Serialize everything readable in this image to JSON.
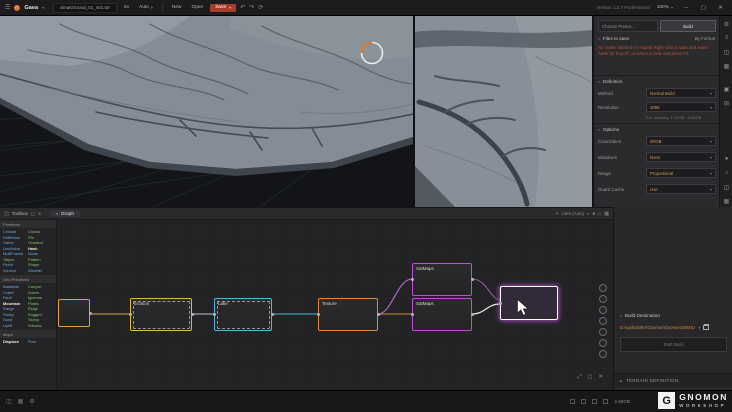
{
  "colors": {
    "accent_orange": "#cf8a3e",
    "warning_text": "#c4502e",
    "save_button": "#a93d2c",
    "node_erosion": "#e5b83c",
    "node_lake": "#49b9dd",
    "node_texture": "#e0883c",
    "node_satmaps": "#bb4fd6",
    "selection_white": "#ffffff",
    "toolbox_blue": "#6fa8dc",
    "toolbox_green": "#85c06a",
    "graph_tab_dot": "#3aa0e8",
    "gizmo_orange": "#e2762c"
  },
  "icons": {
    "menu": "☰",
    "chevron": "▾",
    "minimize": "─",
    "maximize": "▢",
    "close": "✕",
    "undo": "↶",
    "redo": "↷",
    "history": "⟳",
    "plus": "+",
    "home": "⌂",
    "grid": "▦",
    "list": "≡",
    "panel": "◫",
    "gear": "⚙",
    "dot": "●",
    "caret_up": "▲",
    "expand": "⤢",
    "frame": "◻",
    "table": "⊞",
    "square": "▣"
  },
  "titlebar": {
    "app_name": "Gaea",
    "document_tab": "SinaiGround_01_v01.tor",
    "toggle_2x": "2x",
    "auto_label": "Auto",
    "new_label": "New",
    "open_label": "Open",
    "save_label": "Save",
    "version": "Version 1.3.7 Professional",
    "zoom": "100%"
  },
  "build_panel": {
    "preset_placeholder": "Choose Preset...",
    "build_button": "Build",
    "files_to_save": "Files to save",
    "by_format": "By Format",
    "warning": "No nodes marked for export! Right-click a node and select 'Mark for Export', or select a node and press F3.",
    "definition": {
      "title": "Definition",
      "method_label": "Method",
      "method_value": "Normal Build",
      "resolution_label": "Resolution",
      "resolution_value": "4096",
      "memory_note": "Est. memory: 1.02GB - 3.48GB"
    },
    "options": {
      "title": "Options",
      "rows": [
        {
          "label": "Colorization",
          "value": "sRGB"
        },
        {
          "label": "Mutations",
          "value": "None"
        },
        {
          "label": "Range",
          "value": "Proportional"
        },
        {
          "label": "Guard Cache",
          "value": "Use"
        }
      ]
    },
    "build_destination": {
      "title": "Build Destination",
      "path": "D:\\sasha\\DEV\\Gnomon\\Gnomon3dW01r",
      "action": "Start Build"
    },
    "terrain_definition": "TERRAIN DEFINITION"
  },
  "graph": {
    "toolbox_tab": "Toolbox",
    "graph_tab": "Graph",
    "zoom_status": "Lake (Auto)",
    "toolbox": {
      "categories": [
        {
          "name": "Primitives",
          "items": [
            {
              "label": "Cellular"
            },
            {
              "label": "Cracks"
            },
            {
              "label": "DriftNoise"
            },
            {
              "label": "File"
            },
            {
              "label": "Gabor"
            },
            {
              "label": "Gradient"
            },
            {
              "label": "LineNoise"
            },
            {
              "label": "Hash"
            },
            {
              "label": "MultiFractal"
            },
            {
              "label": "Noise"
            },
            {
              "label": "Object"
            },
            {
              "label": "Pattern"
            },
            {
              "label": "Perlin"
            },
            {
              "label": "Shape"
            },
            {
              "label": "Voronoi"
            },
            {
              "label": "Wavelet"
            }
          ]
        },
        {
          "name": "Geo Primitives",
          "items": [
            {
              "label": "Badlands"
            },
            {
              "label": "Canyon"
            },
            {
              "label": "Crater"
            },
            {
              "label": "Dunes"
            },
            {
              "label": "Fault"
            },
            {
              "label": "Igneous"
            },
            {
              "label": "Mountain"
            },
            {
              "label": "Plates"
            },
            {
              "label": "Range"
            },
            {
              "label": "Ridge"
            },
            {
              "label": "Rocky"
            },
            {
              "label": "Rugged"
            },
            {
              "label": "Sand"
            },
            {
              "label": "Slump"
            },
            {
              "label": "Uplift"
            },
            {
              "label": "Volcano"
            }
          ]
        },
        {
          "name": "Maps",
          "items": [
            {
              "label": "Displace"
            },
            {
              "label": "Flow"
            }
          ]
        }
      ]
    },
    "nodes": [
      {
        "label": "Erosion"
      },
      {
        "label": "Lake"
      },
      {
        "label": "Texture"
      },
      {
        "label": "SatMaps"
      },
      {
        "label": "SatMaps"
      }
    ]
  },
  "statusbar": {
    "memory": "2.88GB"
  },
  "watermark": {
    "logo_letter": "G",
    "line1": "GNOMON",
    "line2": "WORKSHOP"
  }
}
